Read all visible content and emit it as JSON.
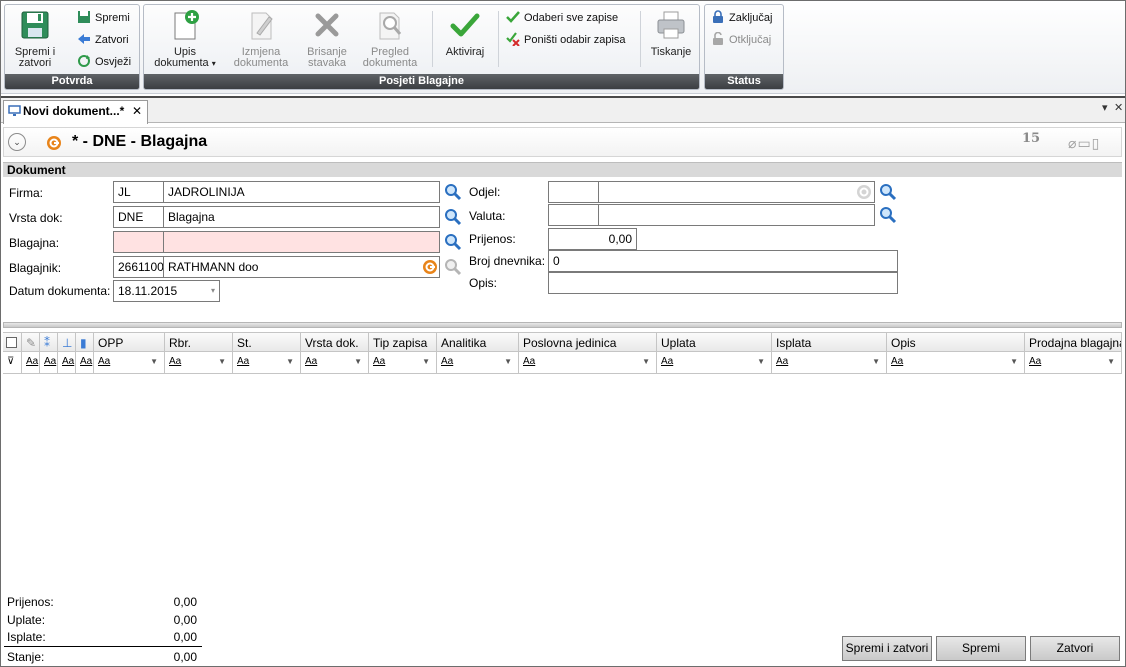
{
  "ribbon": {
    "potvrda": {
      "label": "Potvrda",
      "save_close": "Spremi i\nzatvori",
      "save_close_line1": "Spremi i",
      "save_close_line2": "zatvori",
      "save": "Spremi",
      "close": "Zatvori",
      "refresh": "Osvježi"
    },
    "posjeti": {
      "label": "Posjeti Blagajne",
      "upis_line1": "Upis",
      "upis_line2": "dokumenta",
      "izmjena_line1": "Izmjena",
      "izmjena_line2": "dokumenta",
      "brisanje_line1": "Brisanje",
      "brisanje_line2": "stavaka",
      "pregled_line1": "Pregled",
      "pregled_line2": "dokumenta",
      "aktiviraj": "Aktiviraj",
      "select_all": "Odaberi sve zapise",
      "deselect_all": "Poništi odabir zapisa",
      "tiskanje": "Tiskanje"
    },
    "status": {
      "label": "Status",
      "lock": "Zaključaj",
      "unlock": "Otključaj"
    }
  },
  "tab": {
    "title": "Novi dokument...*",
    "close": "✕"
  },
  "header": {
    "title": "* - DNE - Blagajna",
    "number": "15"
  },
  "section": {
    "title": "Dokument"
  },
  "form": {
    "firma_label": "Firma:",
    "firma_code": "JL",
    "firma_name": "JADROLINIJA",
    "vrsta_label": "Vrsta dok:",
    "vrsta_code": "DNE",
    "vrsta_name": "Blagajna",
    "blagajna_label": "Blagajna:",
    "blagajna_code": "",
    "blagajna_name": "",
    "blagajnik_label": "Blagajnik:",
    "blagajnik_code": "2661100",
    "blagajnik_name": "RATHMANN doo",
    "datum_label": "Datum dokumenta:",
    "datum_value": "18.11.2015",
    "odjel_label": "Odjel:",
    "odjel_code": "",
    "odjel_name": "",
    "valuta_label": "Valuta:",
    "valuta_code": "",
    "valuta_name": "",
    "prijenos_label": "Prijenos:",
    "prijenos_value": "0,00",
    "broj_label": "Broj dnevnika:",
    "broj_value": "0",
    "opis_label": "Opis:",
    "opis_value": ""
  },
  "grid": {
    "columns": [
      "OPP",
      "Rbr.",
      "St.",
      "Vrsta dok.",
      "Tip zapisa",
      "Analitika",
      "Poslovna jedinica",
      "Uplata",
      "Isplata",
      "Opis",
      "Prodajna blagajna"
    ],
    "filter_text": "Aa"
  },
  "totals": {
    "prijenos_label": "Prijenos:",
    "prijenos_value": "0,00",
    "uplate_label": "Uplate:",
    "uplate_value": "0,00",
    "isplate_label": "Isplate:",
    "isplate_value": "0,00",
    "stanje_label": "Stanje:",
    "stanje_value": "0,00"
  },
  "buttons": {
    "save_close": "Spremi i zatvori",
    "save": "Spremi",
    "close": "Zatvori"
  },
  "colors": {
    "required_bg": "#ffe2e2",
    "group_label_bg": "#3b3e42",
    "accent_orange": "#e8841a",
    "check_green": "#3aa63a"
  }
}
